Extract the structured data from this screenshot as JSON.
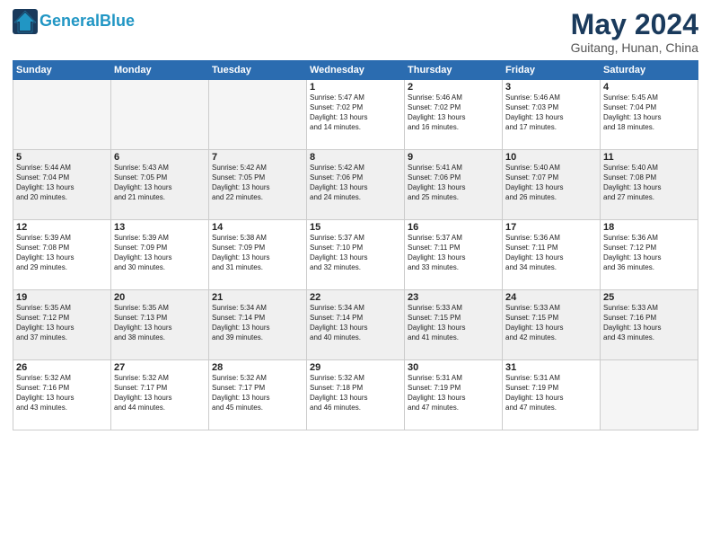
{
  "header": {
    "logo_line1": "General",
    "logo_line2": "Blue",
    "month": "May 2024",
    "location": "Guitang, Hunan, China"
  },
  "weekdays": [
    "Sunday",
    "Monday",
    "Tuesday",
    "Wednesday",
    "Thursday",
    "Friday",
    "Saturday"
  ],
  "weeks": [
    [
      {
        "day": "",
        "info": "",
        "empty": true
      },
      {
        "day": "",
        "info": "",
        "empty": true
      },
      {
        "day": "",
        "info": "",
        "empty": true
      },
      {
        "day": "1",
        "info": "Sunrise: 5:47 AM\nSunset: 7:02 PM\nDaylight: 13 hours\nand 14 minutes."
      },
      {
        "day": "2",
        "info": "Sunrise: 5:46 AM\nSunset: 7:02 PM\nDaylight: 13 hours\nand 16 minutes."
      },
      {
        "day": "3",
        "info": "Sunrise: 5:46 AM\nSunset: 7:03 PM\nDaylight: 13 hours\nand 17 minutes."
      },
      {
        "day": "4",
        "info": "Sunrise: 5:45 AM\nSunset: 7:04 PM\nDaylight: 13 hours\nand 18 minutes."
      }
    ],
    [
      {
        "day": "5",
        "info": "Sunrise: 5:44 AM\nSunset: 7:04 PM\nDaylight: 13 hours\nand 20 minutes.",
        "shaded": true
      },
      {
        "day": "6",
        "info": "Sunrise: 5:43 AM\nSunset: 7:05 PM\nDaylight: 13 hours\nand 21 minutes.",
        "shaded": true
      },
      {
        "day": "7",
        "info": "Sunrise: 5:42 AM\nSunset: 7:05 PM\nDaylight: 13 hours\nand 22 minutes.",
        "shaded": true
      },
      {
        "day": "8",
        "info": "Sunrise: 5:42 AM\nSunset: 7:06 PM\nDaylight: 13 hours\nand 24 minutes.",
        "shaded": true
      },
      {
        "day": "9",
        "info": "Sunrise: 5:41 AM\nSunset: 7:06 PM\nDaylight: 13 hours\nand 25 minutes.",
        "shaded": true
      },
      {
        "day": "10",
        "info": "Sunrise: 5:40 AM\nSunset: 7:07 PM\nDaylight: 13 hours\nand 26 minutes.",
        "shaded": true
      },
      {
        "day": "11",
        "info": "Sunrise: 5:40 AM\nSunset: 7:08 PM\nDaylight: 13 hours\nand 27 minutes.",
        "shaded": true
      }
    ],
    [
      {
        "day": "12",
        "info": "Sunrise: 5:39 AM\nSunset: 7:08 PM\nDaylight: 13 hours\nand 29 minutes."
      },
      {
        "day": "13",
        "info": "Sunrise: 5:39 AM\nSunset: 7:09 PM\nDaylight: 13 hours\nand 30 minutes."
      },
      {
        "day": "14",
        "info": "Sunrise: 5:38 AM\nSunset: 7:09 PM\nDaylight: 13 hours\nand 31 minutes."
      },
      {
        "day": "15",
        "info": "Sunrise: 5:37 AM\nSunset: 7:10 PM\nDaylight: 13 hours\nand 32 minutes."
      },
      {
        "day": "16",
        "info": "Sunrise: 5:37 AM\nSunset: 7:11 PM\nDaylight: 13 hours\nand 33 minutes."
      },
      {
        "day": "17",
        "info": "Sunrise: 5:36 AM\nSunset: 7:11 PM\nDaylight: 13 hours\nand 34 minutes."
      },
      {
        "day": "18",
        "info": "Sunrise: 5:36 AM\nSunset: 7:12 PM\nDaylight: 13 hours\nand 36 minutes."
      }
    ],
    [
      {
        "day": "19",
        "info": "Sunrise: 5:35 AM\nSunset: 7:12 PM\nDaylight: 13 hours\nand 37 minutes.",
        "shaded": true
      },
      {
        "day": "20",
        "info": "Sunrise: 5:35 AM\nSunset: 7:13 PM\nDaylight: 13 hours\nand 38 minutes.",
        "shaded": true
      },
      {
        "day": "21",
        "info": "Sunrise: 5:34 AM\nSunset: 7:14 PM\nDaylight: 13 hours\nand 39 minutes.",
        "shaded": true
      },
      {
        "day": "22",
        "info": "Sunrise: 5:34 AM\nSunset: 7:14 PM\nDaylight: 13 hours\nand 40 minutes.",
        "shaded": true
      },
      {
        "day": "23",
        "info": "Sunrise: 5:33 AM\nSunset: 7:15 PM\nDaylight: 13 hours\nand 41 minutes.",
        "shaded": true
      },
      {
        "day": "24",
        "info": "Sunrise: 5:33 AM\nSunset: 7:15 PM\nDaylight: 13 hours\nand 42 minutes.",
        "shaded": true
      },
      {
        "day": "25",
        "info": "Sunrise: 5:33 AM\nSunset: 7:16 PM\nDaylight: 13 hours\nand 43 minutes.",
        "shaded": true
      }
    ],
    [
      {
        "day": "26",
        "info": "Sunrise: 5:32 AM\nSunset: 7:16 PM\nDaylight: 13 hours\nand 43 minutes."
      },
      {
        "day": "27",
        "info": "Sunrise: 5:32 AM\nSunset: 7:17 PM\nDaylight: 13 hours\nand 44 minutes."
      },
      {
        "day": "28",
        "info": "Sunrise: 5:32 AM\nSunset: 7:17 PM\nDaylight: 13 hours\nand 45 minutes."
      },
      {
        "day": "29",
        "info": "Sunrise: 5:32 AM\nSunset: 7:18 PM\nDaylight: 13 hours\nand 46 minutes."
      },
      {
        "day": "30",
        "info": "Sunrise: 5:31 AM\nSunset: 7:19 PM\nDaylight: 13 hours\nand 47 minutes."
      },
      {
        "day": "31",
        "info": "Sunrise: 5:31 AM\nSunset: 7:19 PM\nDaylight: 13 hours\nand 47 minutes."
      },
      {
        "day": "",
        "info": "",
        "empty": true
      }
    ]
  ]
}
